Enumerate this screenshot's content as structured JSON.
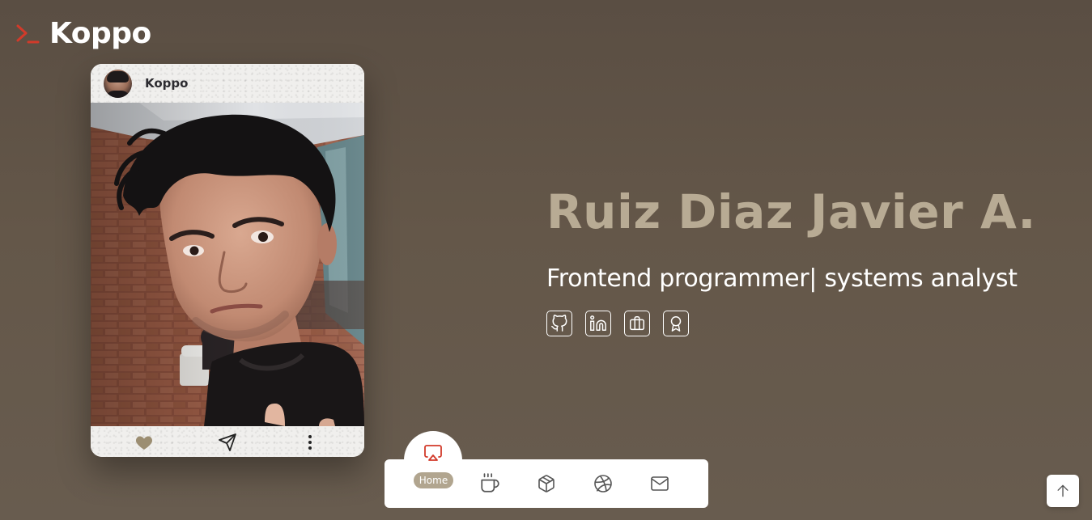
{
  "brand": {
    "name": "Koppo",
    "icon": "terminal-prompt-icon",
    "accent": "#d23a2a"
  },
  "card": {
    "username": "Koppo",
    "actions": [
      "heart-icon",
      "send-icon",
      "more-vertical-icon"
    ]
  },
  "hero": {
    "name": "Ruiz Diaz Javier A.",
    "role": "Frontend programmer| systems analyst",
    "name_color": "#b8ab94",
    "socials": [
      "github-icon",
      "linkedin-icon",
      "briefcase-icon",
      "award-icon"
    ]
  },
  "nav": {
    "active": {
      "label": "Home",
      "icon": "airplay-icon",
      "color": "#d23a2a"
    },
    "items": [
      "coffee-icon",
      "package-icon",
      "dribbble-icon",
      "mail-icon"
    ]
  },
  "scroll_top": {
    "icon": "arrow-up-icon"
  }
}
